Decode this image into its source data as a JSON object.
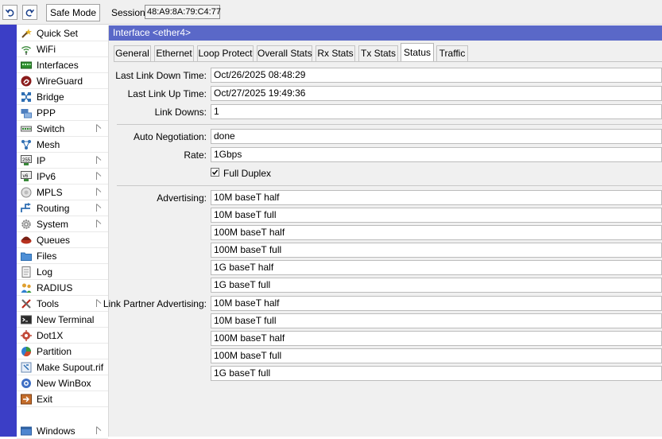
{
  "toolbar": {
    "undo_icon": "undo-icon",
    "redo_icon": "redo-icon",
    "safe_mode_label": "Safe Mode",
    "session_label": "Session:",
    "session_value": "48:A9:8A:79:C4:77"
  },
  "sidebar": {
    "items": [
      {
        "label": "Quick Set",
        "icon": "wand-icon",
        "submenu": false
      },
      {
        "label": "WiFi",
        "icon": "wifi-icon",
        "submenu": false
      },
      {
        "label": "Interfaces",
        "icon": "interfaces-icon",
        "submenu": false
      },
      {
        "label": "WireGuard",
        "icon": "wireguard-icon",
        "submenu": false
      },
      {
        "label": "Bridge",
        "icon": "bridge-icon",
        "submenu": false
      },
      {
        "label": "PPP",
        "icon": "ppp-icon",
        "submenu": false
      },
      {
        "label": "Switch",
        "icon": "switch-icon",
        "submenu": true
      },
      {
        "label": "Mesh",
        "icon": "mesh-icon",
        "submenu": false
      },
      {
        "label": "IP",
        "icon": "ip-icon",
        "submenu": true
      },
      {
        "label": "IPv6",
        "icon": "ipv6-icon",
        "submenu": true
      },
      {
        "label": "MPLS",
        "icon": "mpls-icon",
        "submenu": true
      },
      {
        "label": "Routing",
        "icon": "routing-icon",
        "submenu": true
      },
      {
        "label": "System",
        "icon": "system-gear-icon",
        "submenu": true
      },
      {
        "label": "Queues",
        "icon": "queues-icon",
        "submenu": false
      },
      {
        "label": "Files",
        "icon": "folder-icon",
        "submenu": false
      },
      {
        "label": "Log",
        "icon": "log-icon",
        "submenu": false
      },
      {
        "label": "RADIUS",
        "icon": "radius-users-icon",
        "submenu": false
      },
      {
        "label": "Tools",
        "icon": "tools-icon",
        "submenu": true
      },
      {
        "label": "New Terminal",
        "icon": "terminal-icon",
        "submenu": false
      },
      {
        "label": "Dot1X",
        "icon": "dot1x-icon",
        "submenu": false
      },
      {
        "label": "Partition",
        "icon": "partition-pie-icon",
        "submenu": false
      },
      {
        "label": "Make Supout.rif",
        "icon": "supout-icon",
        "submenu": false
      },
      {
        "label": "New WinBox",
        "icon": "winbox-icon",
        "submenu": false
      },
      {
        "label": "Exit",
        "icon": "exit-icon",
        "submenu": false
      }
    ],
    "windows": {
      "label": "Windows",
      "icon": "windows-icon",
      "submenu": true
    }
  },
  "window": {
    "title": "Interface <ether4>",
    "tabs": [
      "General",
      "Ethernet",
      "Loop Protect",
      "Overall Stats",
      "Rx Stats",
      "Tx Stats",
      "Status",
      "Traffic"
    ],
    "active_tab": "Status"
  },
  "status": {
    "last_link_down_label": "Last Link Down Time:",
    "last_link_down_value": "Oct/26/2025 08:48:29",
    "last_link_up_label": "Last Link Up Time:",
    "last_link_up_value": "Oct/27/2025 19:49:36",
    "link_downs_label": "Link Downs:",
    "link_downs_value": "1",
    "auto_negotiation_label": "Auto Negotiation:",
    "auto_negotiation_value": "done",
    "rate_label": "Rate:",
    "rate_value": "1Gbps",
    "full_duplex_label": "Full Duplex",
    "full_duplex_checked": true,
    "advertising_label": "Advertising:",
    "advertising": [
      "10M baseT half",
      "10M baseT full",
      "100M baseT half",
      "100M baseT full",
      "1G baseT half",
      "1G baseT full"
    ],
    "partner_label": "Link Partner Advertising:",
    "partner_advertising": [
      "10M baseT half",
      "10M baseT full",
      "100M baseT half",
      "100M baseT full",
      "1G baseT full"
    ]
  },
  "colors": {
    "stripe": "#3b3ec6",
    "title_bar": "#5a68c8"
  }
}
